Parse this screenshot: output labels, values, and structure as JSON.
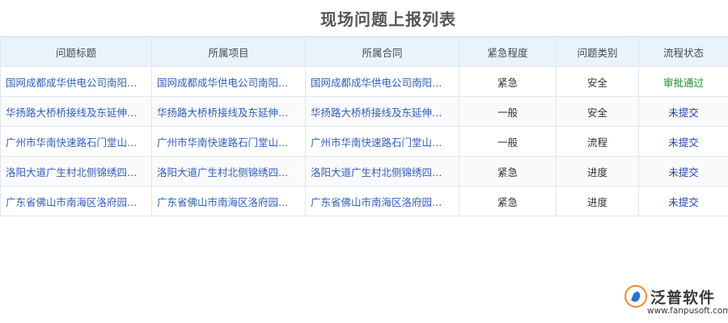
{
  "page": {
    "title": "现场问题上报列表"
  },
  "table": {
    "columns": [
      "问题标题",
      "所属项目",
      "所属合同",
      "紧急程度",
      "问题类别",
      "流程状态"
    ],
    "rows": [
      [
        "国网成都成华供电公司南阳…",
        "国网成都成华供电公司南阳…",
        "国网成都成华供电公司南阳…",
        "紧急",
        "安全",
        "审批通过"
      ],
      [
        "华扬路大桥桥接线及东延伸…",
        "华扬路大桥桥接线及东延伸…",
        "华扬路大桥桥接线及东延伸…",
        "一般",
        "安全",
        "未提交"
      ],
      [
        "广州市华南快速路石门堂山…",
        "广州市华南快速路石门堂山…",
        "广州市华南快速路石门堂山…",
        "一般",
        "流程",
        "未提交"
      ],
      [
        "洛阳大道广生村北侧锦绣四…",
        "洛阳大道广生村北侧锦绣四…",
        "洛阳大道广生村北侧锦绣四…",
        "紧急",
        "进度",
        "未提交"
      ],
      [
        "广东省佛山市南海区洛府园…",
        "广东省佛山市南海区洛府园…",
        "广东省佛山市南海区洛府园…",
        "紧急",
        "进度",
        "未提交"
      ]
    ]
  },
  "colors": {
    "link": "#2f5fbd",
    "approved": "#1f8f2a",
    "pending": "#1f3fae",
    "header_bg": "#e9f3fb"
  },
  "logo": {
    "brand": "泛普软件",
    "url": "www.fanpusoft.com",
    "icon": "fanpu-logo-icon"
  }
}
